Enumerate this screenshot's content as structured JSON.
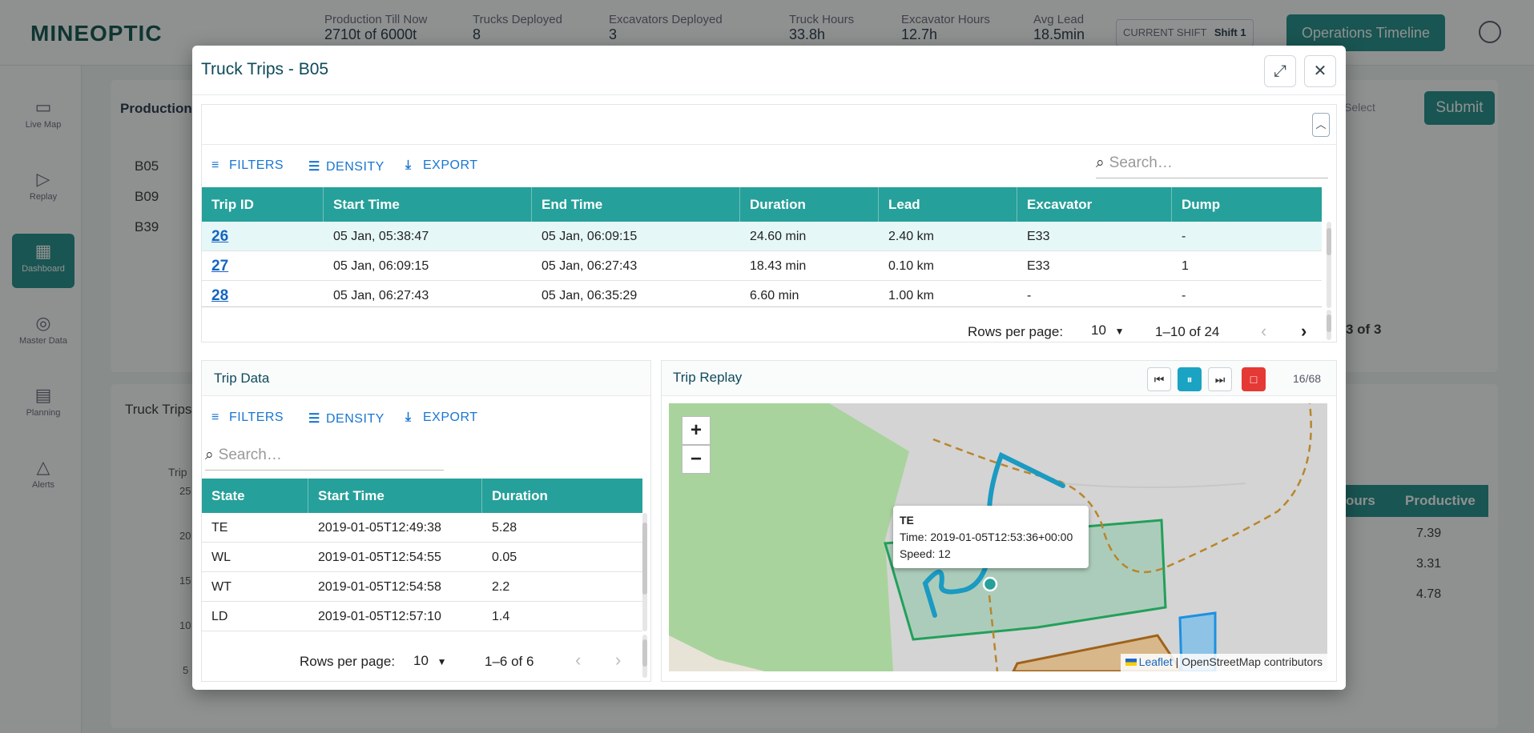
{
  "background": {
    "logo": "MINEOPTIC",
    "kpis": [
      {
        "label": "Production Till Now",
        "value": "2710t of 6000t"
      },
      {
        "label": "Trucks Deployed",
        "value": "8"
      },
      {
        "label": "Excavators Deployed",
        "value": "3"
      },
      {
        "label": "Truck Hours",
        "value": "33.8h"
      },
      {
        "label": "Excavator Hours",
        "value": "12.7h"
      },
      {
        "label": "Avg Lead",
        "value": "18.5min"
      }
    ],
    "shift_label": "CURRENT SHIFT",
    "shift_value": "Shift 1",
    "timeline_button": "Operations Timeline",
    "sidebar": [
      {
        "label": "Live Map"
      },
      {
        "label": "Replay"
      },
      {
        "label": "Dashboard"
      },
      {
        "label": "Master Data"
      },
      {
        "label": "Planning"
      },
      {
        "label": "Alerts"
      }
    ],
    "production_title": "Production",
    "select_label": "Select",
    "submit_label": "Submit",
    "trucks": [
      "B05",
      "B09",
      "B39"
    ],
    "page_frag": "3 of 3",
    "truck_trips_title": "Truck Trips",
    "trip_axis_label": "Trip",
    "y_ticks": [
      "25",
      "20",
      "15",
      "10",
      "5"
    ],
    "right_headers": [
      "ours",
      "Productive"
    ],
    "right_values": [
      "7.39",
      "3.31",
      "4.78"
    ]
  },
  "modal": {
    "title": "Truck Trips - B05",
    "toolbar": {
      "filters": "FILTERS",
      "density": "DENSITY",
      "export": "EXPORT"
    },
    "search_placeholder": "Search…",
    "trips": {
      "columns": [
        "Trip ID",
        "Start Time",
        "End Time",
        "Duration",
        "Lead",
        "Excavator",
        "Dump"
      ],
      "rows": [
        [
          "26",
          "05 Jan, 05:38:47",
          "05 Jan, 06:09:15",
          "24.60 min",
          "2.40 km",
          "E33",
          "-"
        ],
        [
          "27",
          "05 Jan, 06:09:15",
          "05 Jan, 06:27:43",
          "18.43 min",
          "0.10 km",
          "E33",
          "1"
        ],
        [
          "28",
          "05 Jan, 06:27:43",
          "05 Jan, 06:35:29",
          "6.60 min",
          "1.00 km",
          "-",
          "-"
        ]
      ],
      "rows_per_page_label": "Rows per page:",
      "rows_per_page": "10",
      "range": "1–10 of 24"
    },
    "trip_data": {
      "title": "Trip Data",
      "columns": [
        "State",
        "Start Time",
        "Duration"
      ],
      "rows": [
        [
          "TE",
          "2019-01-05T12:49:38",
          "5.28"
        ],
        [
          "WL",
          "2019-01-05T12:54:55",
          "0.05"
        ],
        [
          "WT",
          "2019-01-05T12:54:58",
          "2.2"
        ],
        [
          "LD",
          "2019-01-05T12:57:10",
          "1.4"
        ]
      ],
      "rows_per_page_label": "Rows per page:",
      "rows_per_page": "10",
      "range": "1–6 of 6"
    },
    "replay": {
      "title": "Trip Replay",
      "counter": "16/68",
      "tooltip_state": "TE",
      "tooltip_time": "Time: 2019-01-05T12:53:36+00:00",
      "tooltip_speed": "Speed: 12",
      "attribution_link": "Leaflet",
      "attribution_text": "| OpenStreetMap contributors"
    }
  },
  "colors": {
    "teal": "#26a09a",
    "link": "#1976d2",
    "stop": "#e53935",
    "play": "#1aa3c2",
    "route": "#1b9ac2"
  }
}
